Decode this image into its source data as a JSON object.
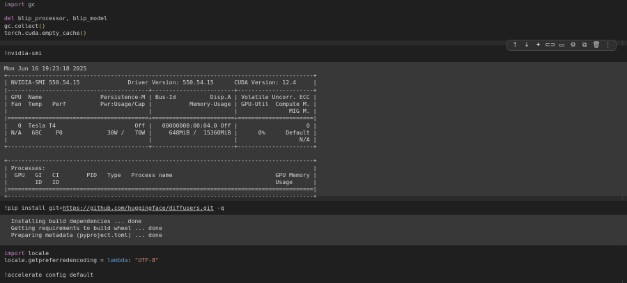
{
  "cell1": {
    "l1_kw": "import",
    "l1_rest": " gc",
    "l3_kw": "del",
    "l3_rest": " blip_processor, blip_model",
    "l4": "gc.collect",
    "l5": "torch.cuda.empty_cache",
    "parens": "()"
  },
  "cell2": {
    "code": "!nvidia-smi"
  },
  "cell2_output": {
    "lines": [
      "Mon Jun 16 19:23:18 2025",
      "+-----------------------------------------------------------------------------------------+",
      "| NVIDIA-SMI 550.54.15              Driver Version: 550.54.15      CUDA Version: 12.4     |",
      "|-----------------------------------------+------------------------+----------------------+",
      "| GPU  Name                 Persistence-M | Bus-Id          Disp.A | Volatile Uncorr. ECC |",
      "| Fan  Temp   Perf          Pwr:Usage/Cap |           Memory-Usage | GPU-Util  Compute M. |",
      "|                                         |                        |               MIG M. |",
      "|=========================================+========================+======================|",
      "|   0  Tesla T4                       Off |   00000000:00:04.0 Off |                    0 |",
      "| N/A   68C    P0             30W /   70W |     648MiB /  15360MiB |      0%      Default |",
      "|                                         |                        |                  N/A |",
      "+-----------------------------------------+------------------------+----------------------+",
      "",
      "+-----------------------------------------------------------------------------------------+",
      "| Processes:                                                                              |",
      "|  GPU   GI   CI        PID   Type   Process name                              GPU Memory |",
      "|        ID   ID                                                               Usage      |",
      "|=========================================================================================|",
      "+-----------------------------------------------------------------------------------------+"
    ]
  },
  "cell3": {
    "prefix": "!pip install git+",
    "url": "https://github.com/huggingface/diffusers.git",
    "suffix": " -q"
  },
  "cell3_output": {
    "lines": [
      "  Installing build dependencies ... done",
      "  Getting requirements to build wheel ... done",
      "  Preparing metadata (pyproject.toml) ... done"
    ]
  },
  "cell4": {
    "l1_kw": "import",
    "l1_rest": " locale",
    "l2_a": "locale.getpreferredencoding = ",
    "l2_lambda": "lambda",
    "l2_colon": ": ",
    "l2_str": "\"UTF-8\"",
    "l4": "!accelerate config default"
  },
  "toolbar": {
    "items": [
      {
        "name": "move-up",
        "glyph": "↑"
      },
      {
        "name": "move-down",
        "glyph": "↓"
      },
      {
        "name": "sparkle",
        "glyph": "✦"
      },
      {
        "name": "link",
        "glyph": "⊂⊃"
      },
      {
        "name": "comment",
        "glyph": "▭"
      },
      {
        "name": "settings",
        "glyph": "⚙"
      },
      {
        "name": "copy",
        "glyph": "⧉"
      },
      {
        "name": "delete",
        "glyph": "🗑"
      },
      {
        "name": "more",
        "glyph": "⋮"
      }
    ]
  }
}
